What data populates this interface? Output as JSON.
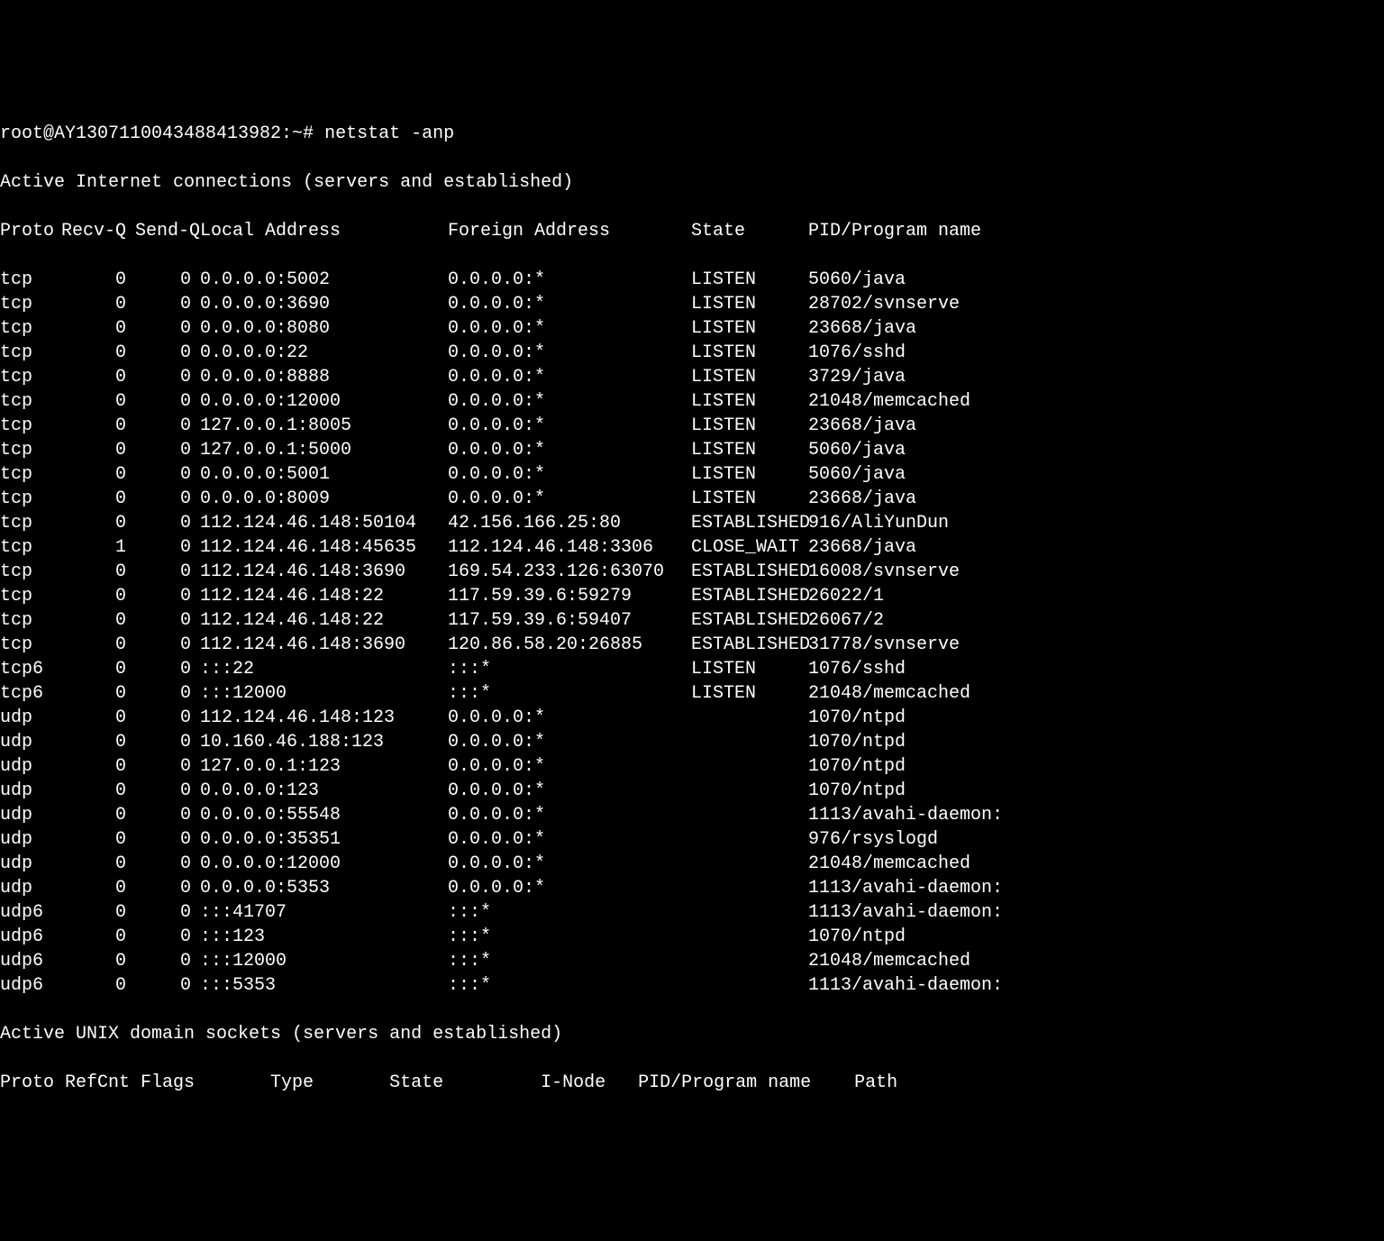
{
  "prompt": "root@AY1307110043488413982:~# ",
  "command": "netstat -anp",
  "title_line": "Active Internet connections (servers and established)",
  "headers": {
    "proto": "Proto",
    "recvq": "Recv-Q",
    "sendq": "Send-Q",
    "local": "Local Address",
    "foreign": "Foreign Address",
    "state": "State",
    "pid": "PID/Program name"
  },
  "rows": [
    {
      "proto": "tcp",
      "recvq": "0",
      "sendq": "0",
      "local": "0.0.0.0:5002",
      "foreign": "0.0.0.0:*",
      "state": "LISTEN",
      "pid": "5060/java"
    },
    {
      "proto": "tcp",
      "recvq": "0",
      "sendq": "0",
      "local": "0.0.0.0:3690",
      "foreign": "0.0.0.0:*",
      "state": "LISTEN",
      "pid": "28702/svnserve"
    },
    {
      "proto": "tcp",
      "recvq": "0",
      "sendq": "0",
      "local": "0.0.0.0:8080",
      "foreign": "0.0.0.0:*",
      "state": "LISTEN",
      "pid": "23668/java"
    },
    {
      "proto": "tcp",
      "recvq": "0",
      "sendq": "0",
      "local": "0.0.0.0:22",
      "foreign": "0.0.0.0:*",
      "state": "LISTEN",
      "pid": "1076/sshd"
    },
    {
      "proto": "tcp",
      "recvq": "0",
      "sendq": "0",
      "local": "0.0.0.0:8888",
      "foreign": "0.0.0.0:*",
      "state": "LISTEN",
      "pid": "3729/java"
    },
    {
      "proto": "tcp",
      "recvq": "0",
      "sendq": "0",
      "local": "0.0.0.0:12000",
      "foreign": "0.0.0.0:*",
      "state": "LISTEN",
      "pid": "21048/memcached"
    },
    {
      "proto": "tcp",
      "recvq": "0",
      "sendq": "0",
      "local": "127.0.0.1:8005",
      "foreign": "0.0.0.0:*",
      "state": "LISTEN",
      "pid": "23668/java"
    },
    {
      "proto": "tcp",
      "recvq": "0",
      "sendq": "0",
      "local": "127.0.0.1:5000",
      "foreign": "0.0.0.0:*",
      "state": "LISTEN",
      "pid": "5060/java"
    },
    {
      "proto": "tcp",
      "recvq": "0",
      "sendq": "0",
      "local": "0.0.0.0:5001",
      "foreign": "0.0.0.0:*",
      "state": "LISTEN",
      "pid": "5060/java"
    },
    {
      "proto": "tcp",
      "recvq": "0",
      "sendq": "0",
      "local": "0.0.0.0:8009",
      "foreign": "0.0.0.0:*",
      "state": "LISTEN",
      "pid": "23668/java"
    },
    {
      "proto": "tcp",
      "recvq": "0",
      "sendq": "0",
      "local": "112.124.46.148:50104",
      "foreign": "42.156.166.25:80",
      "state": "ESTABLISHED",
      "pid": "916/AliYunDun"
    },
    {
      "proto": "tcp",
      "recvq": "1",
      "sendq": "0",
      "local": "112.124.46.148:45635",
      "foreign": "112.124.46.148:3306",
      "state": "CLOSE_WAIT",
      "pid": "23668/java"
    },
    {
      "proto": "tcp",
      "recvq": "0",
      "sendq": "0",
      "local": "112.124.46.148:3690",
      "foreign": "169.54.233.126:63070",
      "state": "ESTABLISHED",
      "pid": "16008/svnserve"
    },
    {
      "proto": "tcp",
      "recvq": "0",
      "sendq": "0",
      "local": "112.124.46.148:22",
      "foreign": "117.59.39.6:59279",
      "state": "ESTABLISHED",
      "pid": "26022/1"
    },
    {
      "proto": "tcp",
      "recvq": "0",
      "sendq": "0",
      "local": "112.124.46.148:22",
      "foreign": "117.59.39.6:59407",
      "state": "ESTABLISHED",
      "pid": "26067/2"
    },
    {
      "proto": "tcp",
      "recvq": "0",
      "sendq": "0",
      "local": "112.124.46.148:3690",
      "foreign": "120.86.58.20:26885",
      "state": "ESTABLISHED",
      "pid": "31778/svnserve"
    },
    {
      "proto": "tcp6",
      "recvq": "0",
      "sendq": "0",
      "local": ":::22",
      "foreign": ":::*",
      "state": "LISTEN",
      "pid": "1076/sshd"
    },
    {
      "proto": "tcp6",
      "recvq": "0",
      "sendq": "0",
      "local": ":::12000",
      "foreign": ":::*",
      "state": "LISTEN",
      "pid": "21048/memcached"
    },
    {
      "proto": "udp",
      "recvq": "0",
      "sendq": "0",
      "local": "112.124.46.148:123",
      "foreign": "0.0.0.0:*",
      "state": "",
      "pid": "1070/ntpd"
    },
    {
      "proto": "udp",
      "recvq": "0",
      "sendq": "0",
      "local": "10.160.46.188:123",
      "foreign": "0.0.0.0:*",
      "state": "",
      "pid": "1070/ntpd"
    },
    {
      "proto": "udp",
      "recvq": "0",
      "sendq": "0",
      "local": "127.0.0.1:123",
      "foreign": "0.0.0.0:*",
      "state": "",
      "pid": "1070/ntpd"
    },
    {
      "proto": "udp",
      "recvq": "0",
      "sendq": "0",
      "local": "0.0.0.0:123",
      "foreign": "0.0.0.0:*",
      "state": "",
      "pid": "1070/ntpd"
    },
    {
      "proto": "udp",
      "recvq": "0",
      "sendq": "0",
      "local": "0.0.0.0:55548",
      "foreign": "0.0.0.0:*",
      "state": "",
      "pid": "1113/avahi-daemon:"
    },
    {
      "proto": "udp",
      "recvq": "0",
      "sendq": "0",
      "local": "0.0.0.0:35351",
      "foreign": "0.0.0.0:*",
      "state": "",
      "pid": "976/rsyslogd"
    },
    {
      "proto": "udp",
      "recvq": "0",
      "sendq": "0",
      "local": "0.0.0.0:12000",
      "foreign": "0.0.0.0:*",
      "state": "",
      "pid": "21048/memcached"
    },
    {
      "proto": "udp",
      "recvq": "0",
      "sendq": "0",
      "local": "0.0.0.0:5353",
      "foreign": "0.0.0.0:*",
      "state": "",
      "pid": "1113/avahi-daemon:"
    },
    {
      "proto": "udp6",
      "recvq": "0",
      "sendq": "0",
      "local": ":::41707",
      "foreign": ":::*",
      "state": "",
      "pid": "1113/avahi-daemon:"
    },
    {
      "proto": "udp6",
      "recvq": "0",
      "sendq": "0",
      "local": ":::123",
      "foreign": ":::*",
      "state": "",
      "pid": "1070/ntpd"
    },
    {
      "proto": "udp6",
      "recvq": "0",
      "sendq": "0",
      "local": ":::12000",
      "foreign": ":::*",
      "state": "",
      "pid": "21048/memcached"
    },
    {
      "proto": "udp6",
      "recvq": "0",
      "sendq": "0",
      "local": ":::5353",
      "foreign": ":::*",
      "state": "",
      "pid": "1113/avahi-daemon:"
    }
  ],
  "unix_title": "Active UNIX domain sockets (servers and established)",
  "unix_headers": "Proto RefCnt Flags       Type       State         I-Node   PID/Program name    Path"
}
